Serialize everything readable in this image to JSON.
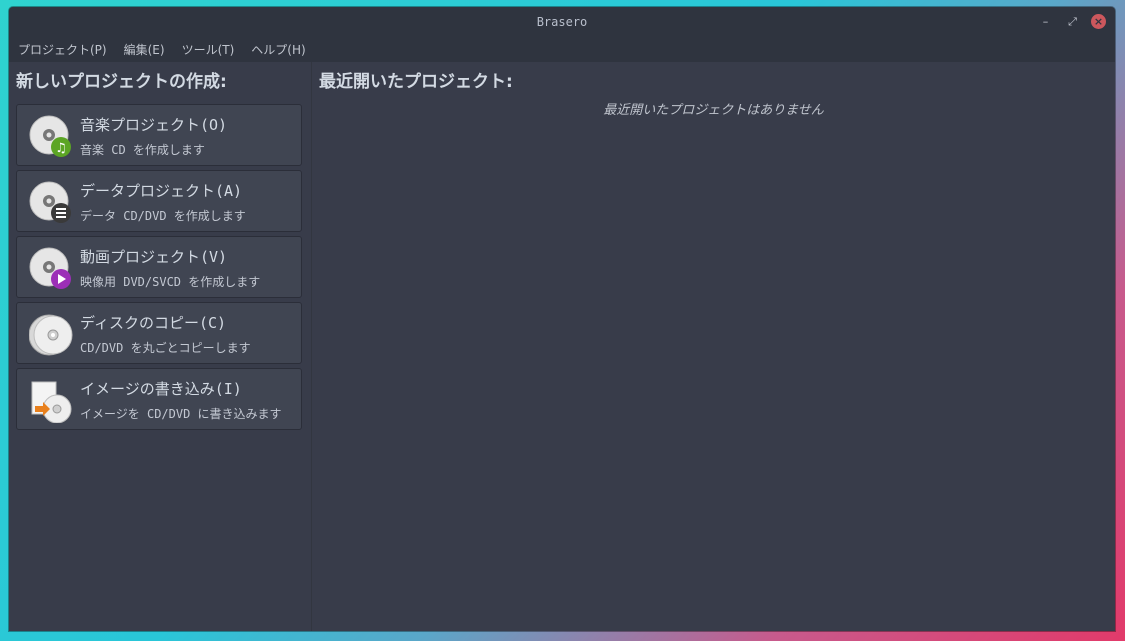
{
  "window": {
    "title": "Brasero"
  },
  "menu": [
    {
      "label": "プロジェクト(P)"
    },
    {
      "label": "編集(E)"
    },
    {
      "label": "ツール(T)"
    },
    {
      "label": "ヘルプ(H)"
    }
  ],
  "left": {
    "title": "新しいプロジェクトの作成:",
    "cards": [
      {
        "label": "音楽プロジェクト(O)",
        "desc": "音楽 CD を作成します",
        "icon": "audio-disc-icon",
        "badge_color": "#5ca524"
      },
      {
        "label": "データプロジェクト(A)",
        "desc": "データ CD/DVD を作成します",
        "icon": "data-disc-icon",
        "badge_color": "#3a3a3a"
      },
      {
        "label": "動画プロジェクト(V)",
        "desc": "映像用 DVD/SVCD を作成します",
        "icon": "video-disc-icon",
        "badge_color": "#9c2fb7"
      },
      {
        "label": "ディスクのコピー(C)",
        "desc": "CD/DVD を丸ごとコピーします",
        "icon": "copy-disc-icon"
      },
      {
        "label": "イメージの書き込み(I)",
        "desc": "イメージを CD/DVD に書き込みます",
        "icon": "burn-image-icon",
        "badge_color": "#e8801d"
      }
    ]
  },
  "right": {
    "title": "最近開いたプロジェクト:",
    "empty_text": "最近開いたプロジェクトはありません"
  }
}
